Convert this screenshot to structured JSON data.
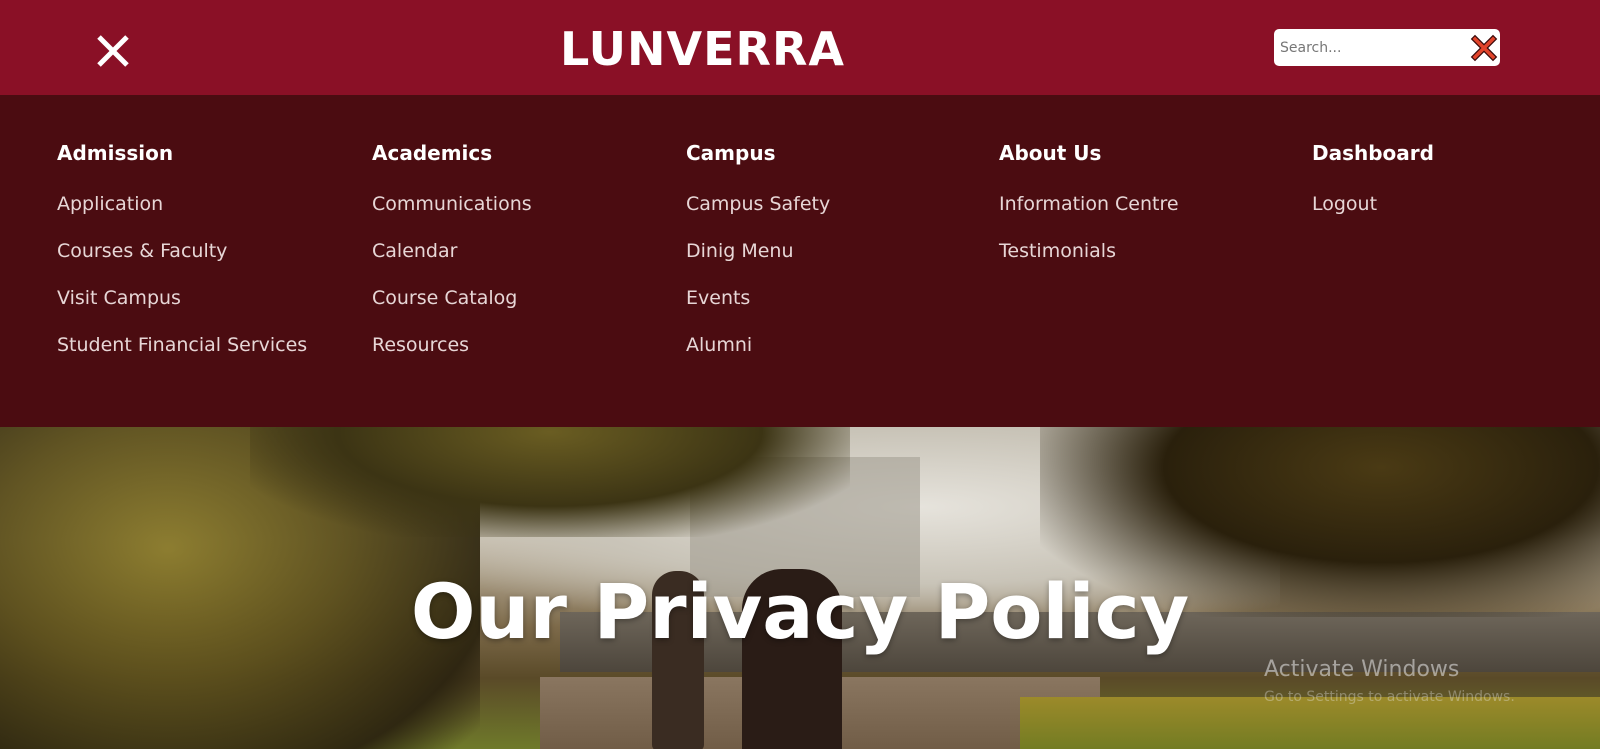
{
  "header": {
    "logo_text": "LUNVERRA",
    "close_icon": "close-icon",
    "search": {
      "placeholder": "Search...",
      "value": "",
      "clear_icon": "close-x-icon"
    }
  },
  "colors": {
    "header_bg": "#8a1026",
    "menu_bg": "#4b0c11",
    "search_clear_red": "#e2442b"
  },
  "menu": {
    "columns": [
      {
        "heading": "Admission",
        "items": [
          "Application",
          "Courses & Faculty",
          "Visit Campus",
          "Student Financial Services"
        ]
      },
      {
        "heading": "Academics",
        "items": [
          "Communications",
          "Calendar",
          "Course Catalog",
          "Resources"
        ]
      },
      {
        "heading": "Campus",
        "items": [
          "Campus Safety",
          "Dinig Menu",
          "Events",
          "Alumni"
        ]
      },
      {
        "heading": "About Us",
        "items": [
          "Information Centre",
          "Testimonials"
        ]
      },
      {
        "heading": "Dashboard",
        "items": [
          "Logout"
        ]
      }
    ]
  },
  "hero": {
    "title": "Our Privacy Policy"
  },
  "os_overlay": {
    "watermark": "Activate Windows",
    "watermark_sub": "Go to Settings to activate Windows."
  }
}
